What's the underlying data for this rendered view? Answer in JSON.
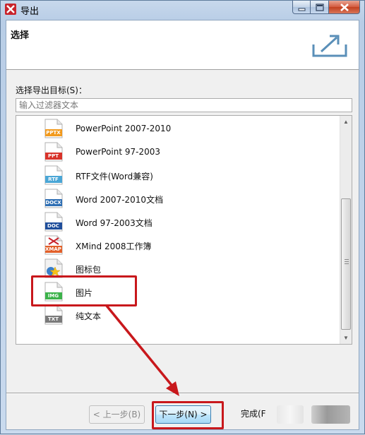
{
  "window": {
    "title": "导出",
    "min_icon": "minimize-icon",
    "max_icon": "maximize-icon",
    "close_icon": "close-icon"
  },
  "header": {
    "title": "选择",
    "icon": "export-icon"
  },
  "target": {
    "label": "选择导出目标(S)：",
    "filter_placeholder": "输入过滤器文本"
  },
  "items": [
    {
      "label": "PowerPoint 2007-2010",
      "tag": "PPTX",
      "color": "#f29a1d"
    },
    {
      "label": "PowerPoint 97-2003",
      "tag": "PPT",
      "color": "#d8332a"
    },
    {
      "label": "RTF文件(Word兼容)",
      "tag": "RTF",
      "color": "#4aa6d6"
    },
    {
      "label": "Word 2007-2010文档",
      "tag": "DOCX",
      "color": "#2f6fb4"
    },
    {
      "label": "Word 97-2003文档",
      "tag": "DOC",
      "color": "#1f4e9b"
    },
    {
      "label": "XMind 2008工作簿",
      "tag": "XMAP",
      "color": "#e2602a"
    },
    {
      "label": "图标包",
      "tag": "",
      "color": "#3a7fc9"
    },
    {
      "label": "图片",
      "tag": "IMG",
      "color": "#3cb24a"
    },
    {
      "label": "纯文本",
      "tag": "TXT",
      "color": "#7a7a7a"
    }
  ],
  "buttons": {
    "back": "< 上一步(B)",
    "next": "下一步(N) >",
    "finish": "完成(F"
  },
  "colors": {
    "highlight": "#c8181c"
  }
}
